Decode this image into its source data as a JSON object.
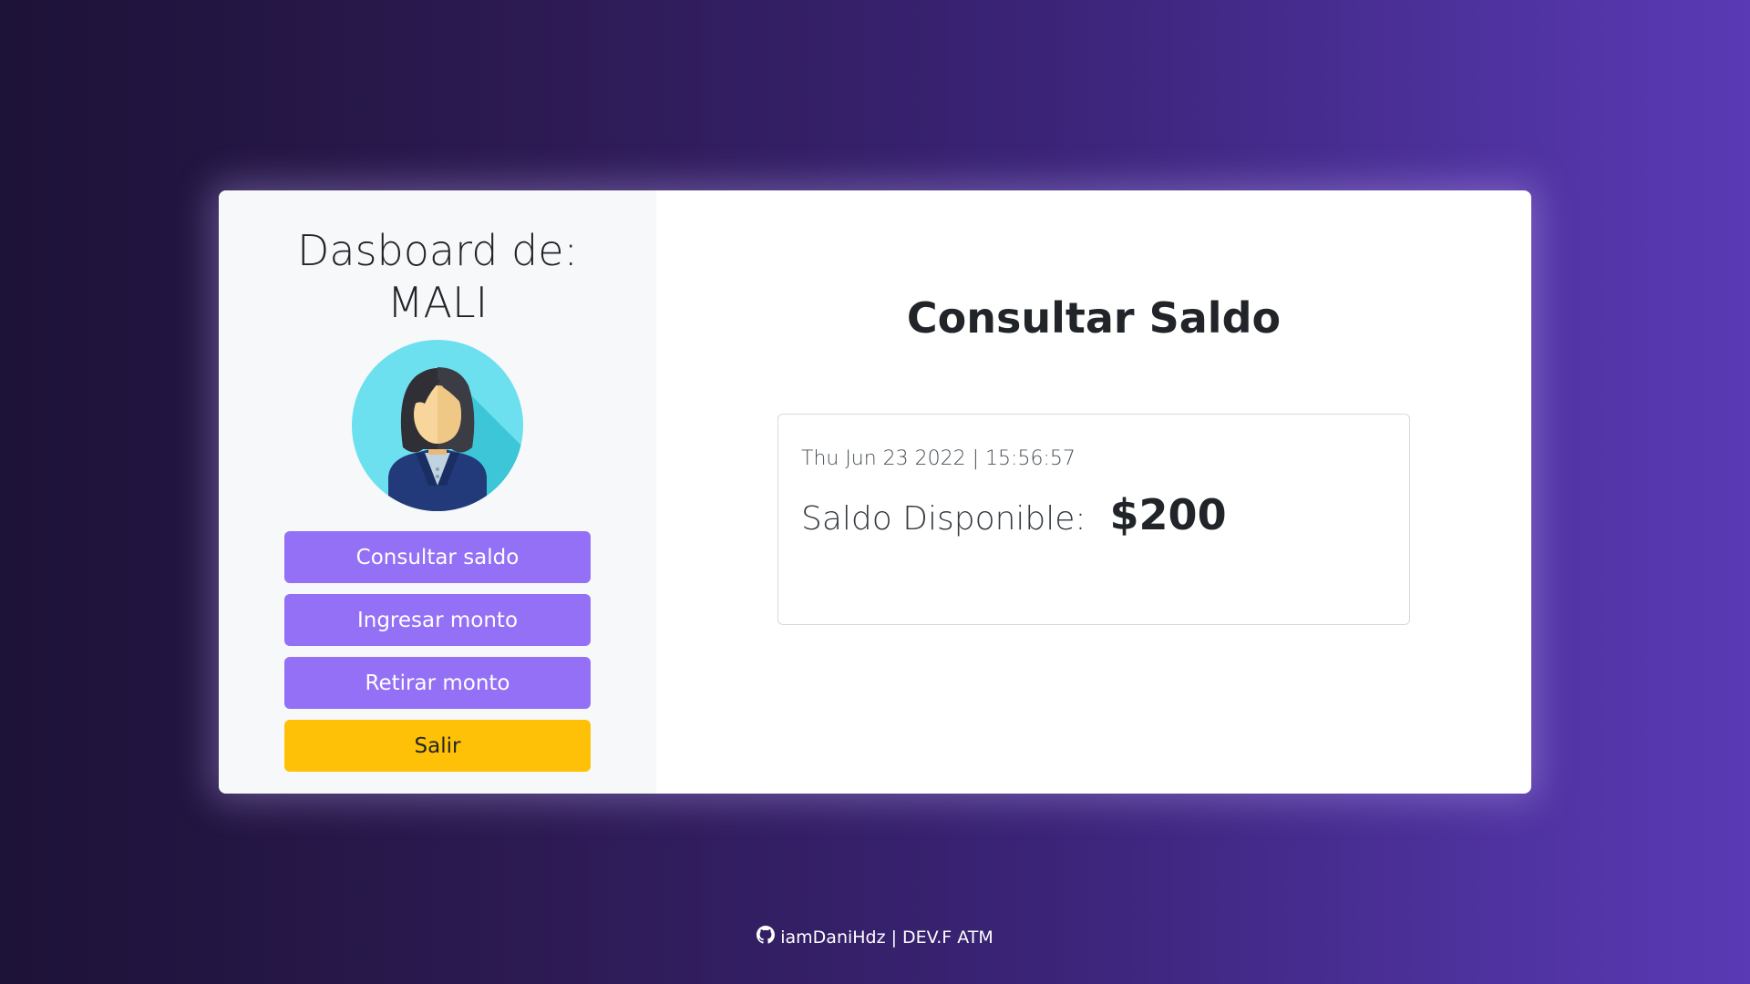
{
  "sidebar": {
    "title_line1": "Dasboard de:",
    "title_line2": "MALI",
    "avatar_icon": "woman-avatar-icon",
    "buttons": [
      {
        "label": "Consultar saldo"
      },
      {
        "label": "Ingresar monto"
      },
      {
        "label": "Retirar monto"
      },
      {
        "label": "Salir"
      }
    ]
  },
  "main": {
    "title": "Consultar Saldo",
    "timestamp": "Thu Jun 23 2022 | 15:56:57",
    "balance_label": "Saldo Disponible:",
    "balance_value": "$200"
  },
  "footer": {
    "icon": "github-icon",
    "username": "iamDaniHdz",
    "separator": "|",
    "project": "DEV.F ATM"
  },
  "colors": {
    "primary_button": "#9370f5",
    "exit_button": "#ffc107",
    "background_start": "#1d1237",
    "background_end": "#5a3ab5"
  }
}
